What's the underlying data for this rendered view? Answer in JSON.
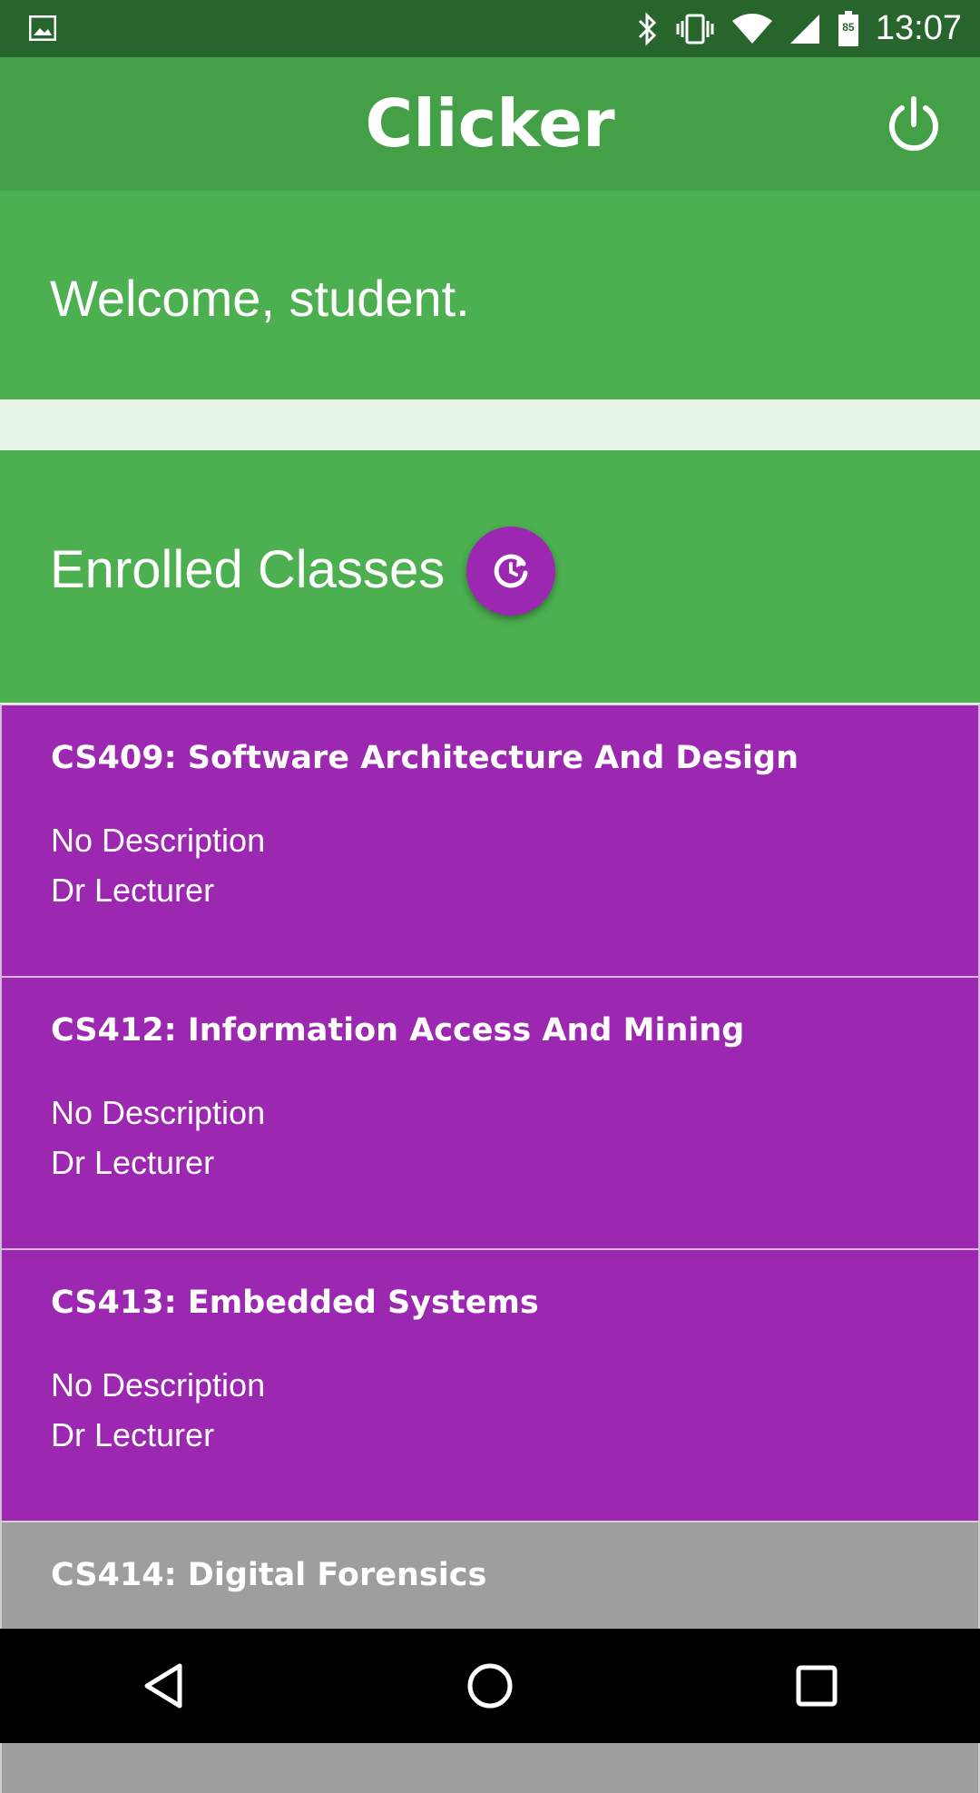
{
  "status_bar": {
    "time": "13:07",
    "battery_level": "85",
    "icons": [
      "image-icon",
      "bluetooth-icon",
      "vibrate-icon",
      "wifi-icon",
      "cell-signal-icon",
      "battery-icon"
    ]
  },
  "app_bar": {
    "title": "Clicker",
    "power_icon": "power-icon"
  },
  "welcome": {
    "text": "Welcome, student."
  },
  "enrolled": {
    "title": "Enrolled Classes",
    "refresh_icon": "refresh-icon"
  },
  "classes": [
    {
      "title": "CS409: Software Architecture And Design",
      "description": "No Description",
      "lecturer": "Dr Lecturer"
    },
    {
      "title": "CS412: Information Access And Mining",
      "description": "No Description",
      "lecturer": "Dr Lecturer"
    },
    {
      "title": "CS413: Embedded Systems",
      "description": "No Description",
      "lecturer": "Dr Lecturer"
    },
    {
      "title": "CS414: Digital Forensics"
    }
  ],
  "nav_bar": {
    "icons": [
      "back-icon",
      "home-icon",
      "recents-icon"
    ]
  },
  "colors": {
    "status_bar": "#27652C",
    "app_bar": "#43A047",
    "section_green": "#4CAF50",
    "accent_purple": "#9C27B0",
    "disabled_gray": "#9E9E9E"
  }
}
